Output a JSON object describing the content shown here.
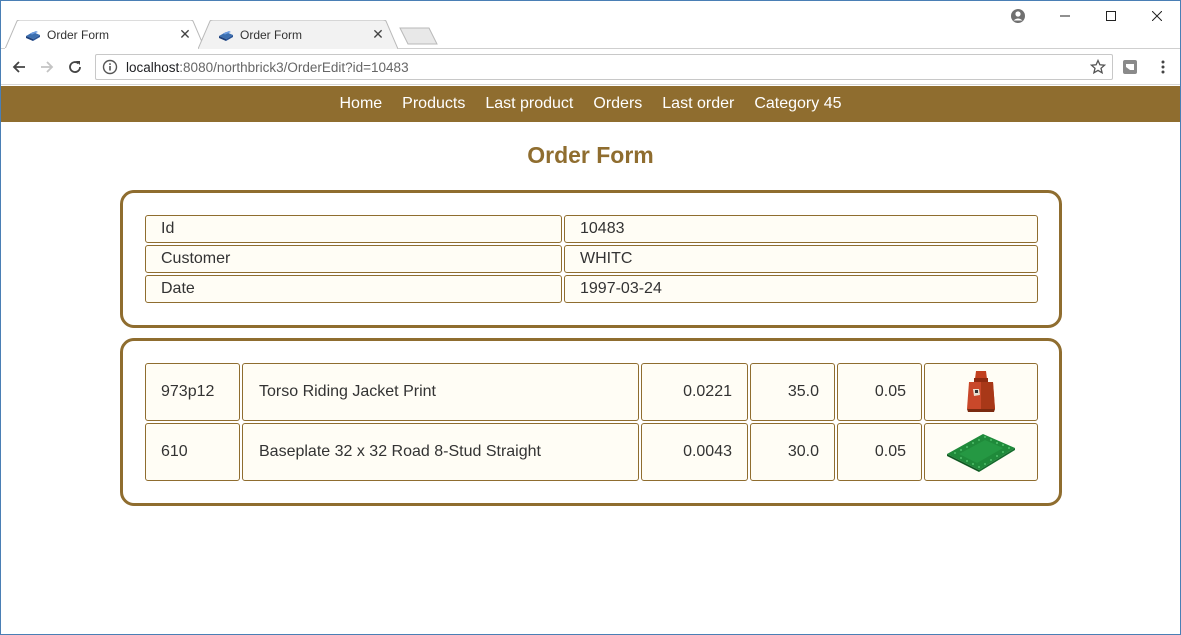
{
  "browser": {
    "tabs": [
      {
        "title": "Order Form",
        "active": true
      },
      {
        "title": "Order Form",
        "active": false
      }
    ],
    "url_host": "localhost",
    "url_rest": ":8080/northbrick3/OrderEdit?id=10483"
  },
  "nav": {
    "items": [
      "Home",
      "Products",
      "Last product",
      "Orders",
      "Last order",
      "Category 45"
    ]
  },
  "page": {
    "title": "Order Form"
  },
  "order": {
    "fields": [
      {
        "label": "Id",
        "value": "10483"
      },
      {
        "label": "Customer",
        "value": "WHITC"
      },
      {
        "label": "Date",
        "value": "1997-03-24"
      }
    ]
  },
  "lines": [
    {
      "part": "973p12",
      "name": "Torso Riding Jacket Print",
      "weight": "0.0221",
      "price": "35.0",
      "discount": "0.05",
      "image": "torso-icon"
    },
    {
      "part": "610",
      "name": "Baseplate 32 x 32 Road 8-Stud Straight",
      "weight": "0.0043",
      "price": "30.0",
      "discount": "0.05",
      "image": "baseplate-icon"
    }
  ],
  "colors": {
    "brand": "#8f6d2f",
    "cell_bg": "#fffdf5"
  }
}
